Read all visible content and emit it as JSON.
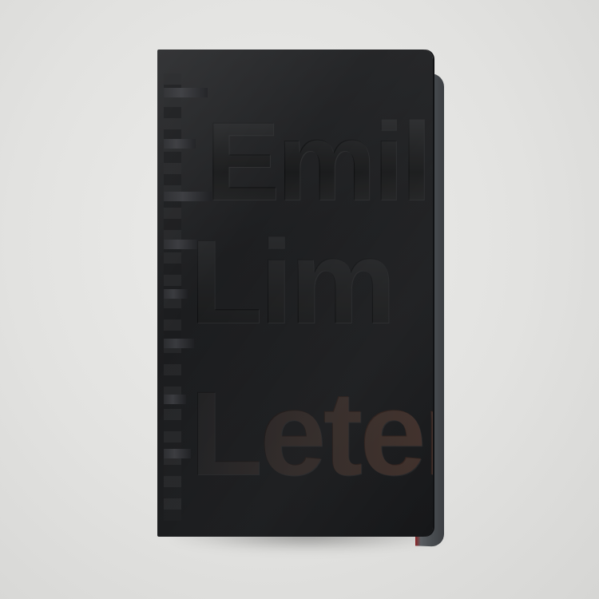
{
  "photo": {
    "subject": "notebook",
    "cover_lines": [
      "Emil",
      "Lim",
      "Leter"
    ],
    "colors": {
      "background": "#e4e4e2",
      "cover": "#1d1e20",
      "edge": "#4a4e52",
      "accent_edge": "#b3262a"
    }
  }
}
